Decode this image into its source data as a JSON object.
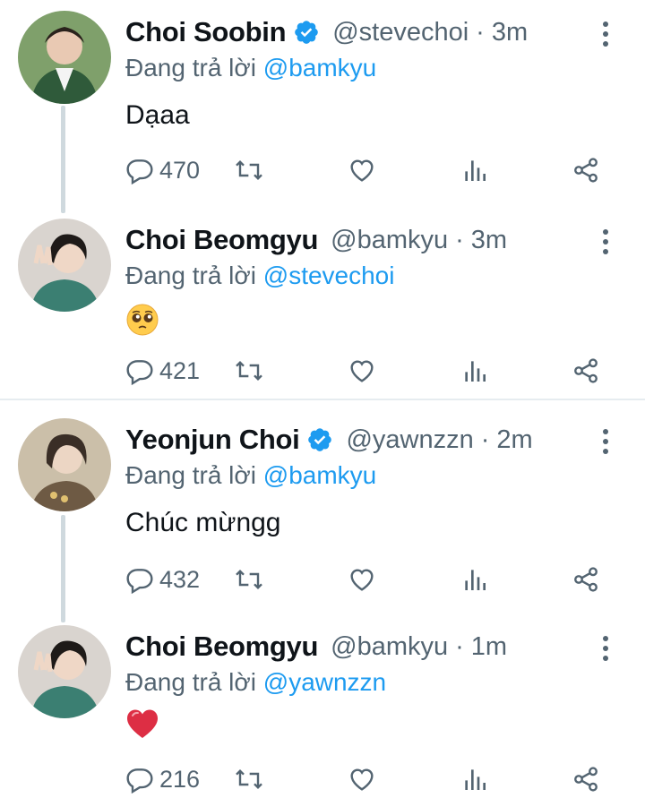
{
  "tweets": [
    {
      "name": "Choi Soobin",
      "verified": true,
      "handle": "@stevechoi",
      "dot": "·",
      "time": "3m",
      "reply_prefix": "Đang trả lời",
      "reply_to": "@bamkyu",
      "text": "Dạaa",
      "emoji": "",
      "reply_count": "470",
      "avatar_color": "#3f6b3a"
    },
    {
      "name": "Choi Beomgyu",
      "verified": false,
      "handle": "@bamkyu",
      "dot": "·",
      "time": "3m",
      "reply_prefix": "Đang trả lời",
      "reply_to": "@stevechoi",
      "text": "",
      "emoji": "pleading-face",
      "reply_count": "421",
      "avatar_color": "#5b7d6a"
    },
    {
      "name": "Yeonjun Choi",
      "verified": true,
      "handle": "@yawnzzn",
      "dot": "·",
      "time": "2m",
      "reply_prefix": "Đang trả lời",
      "reply_to": "@bamkyu",
      "text": "Chúc mừngg",
      "emoji": "",
      "reply_count": "432",
      "avatar_color": "#8a7a64"
    },
    {
      "name": "Choi Beomgyu",
      "verified": false,
      "handle": "@bamkyu",
      "dot": "·",
      "time": "1m",
      "reply_prefix": "Đang trả lời",
      "reply_to": "@yawnzzn",
      "text": "",
      "emoji": "red-heart",
      "reply_count": "216",
      "avatar_color": "#5b7d6a"
    }
  ],
  "colors": {
    "accent": "#1d9bf0",
    "muted": "#536471",
    "text": "#0f1419",
    "thread_line": "#cfd9de"
  }
}
